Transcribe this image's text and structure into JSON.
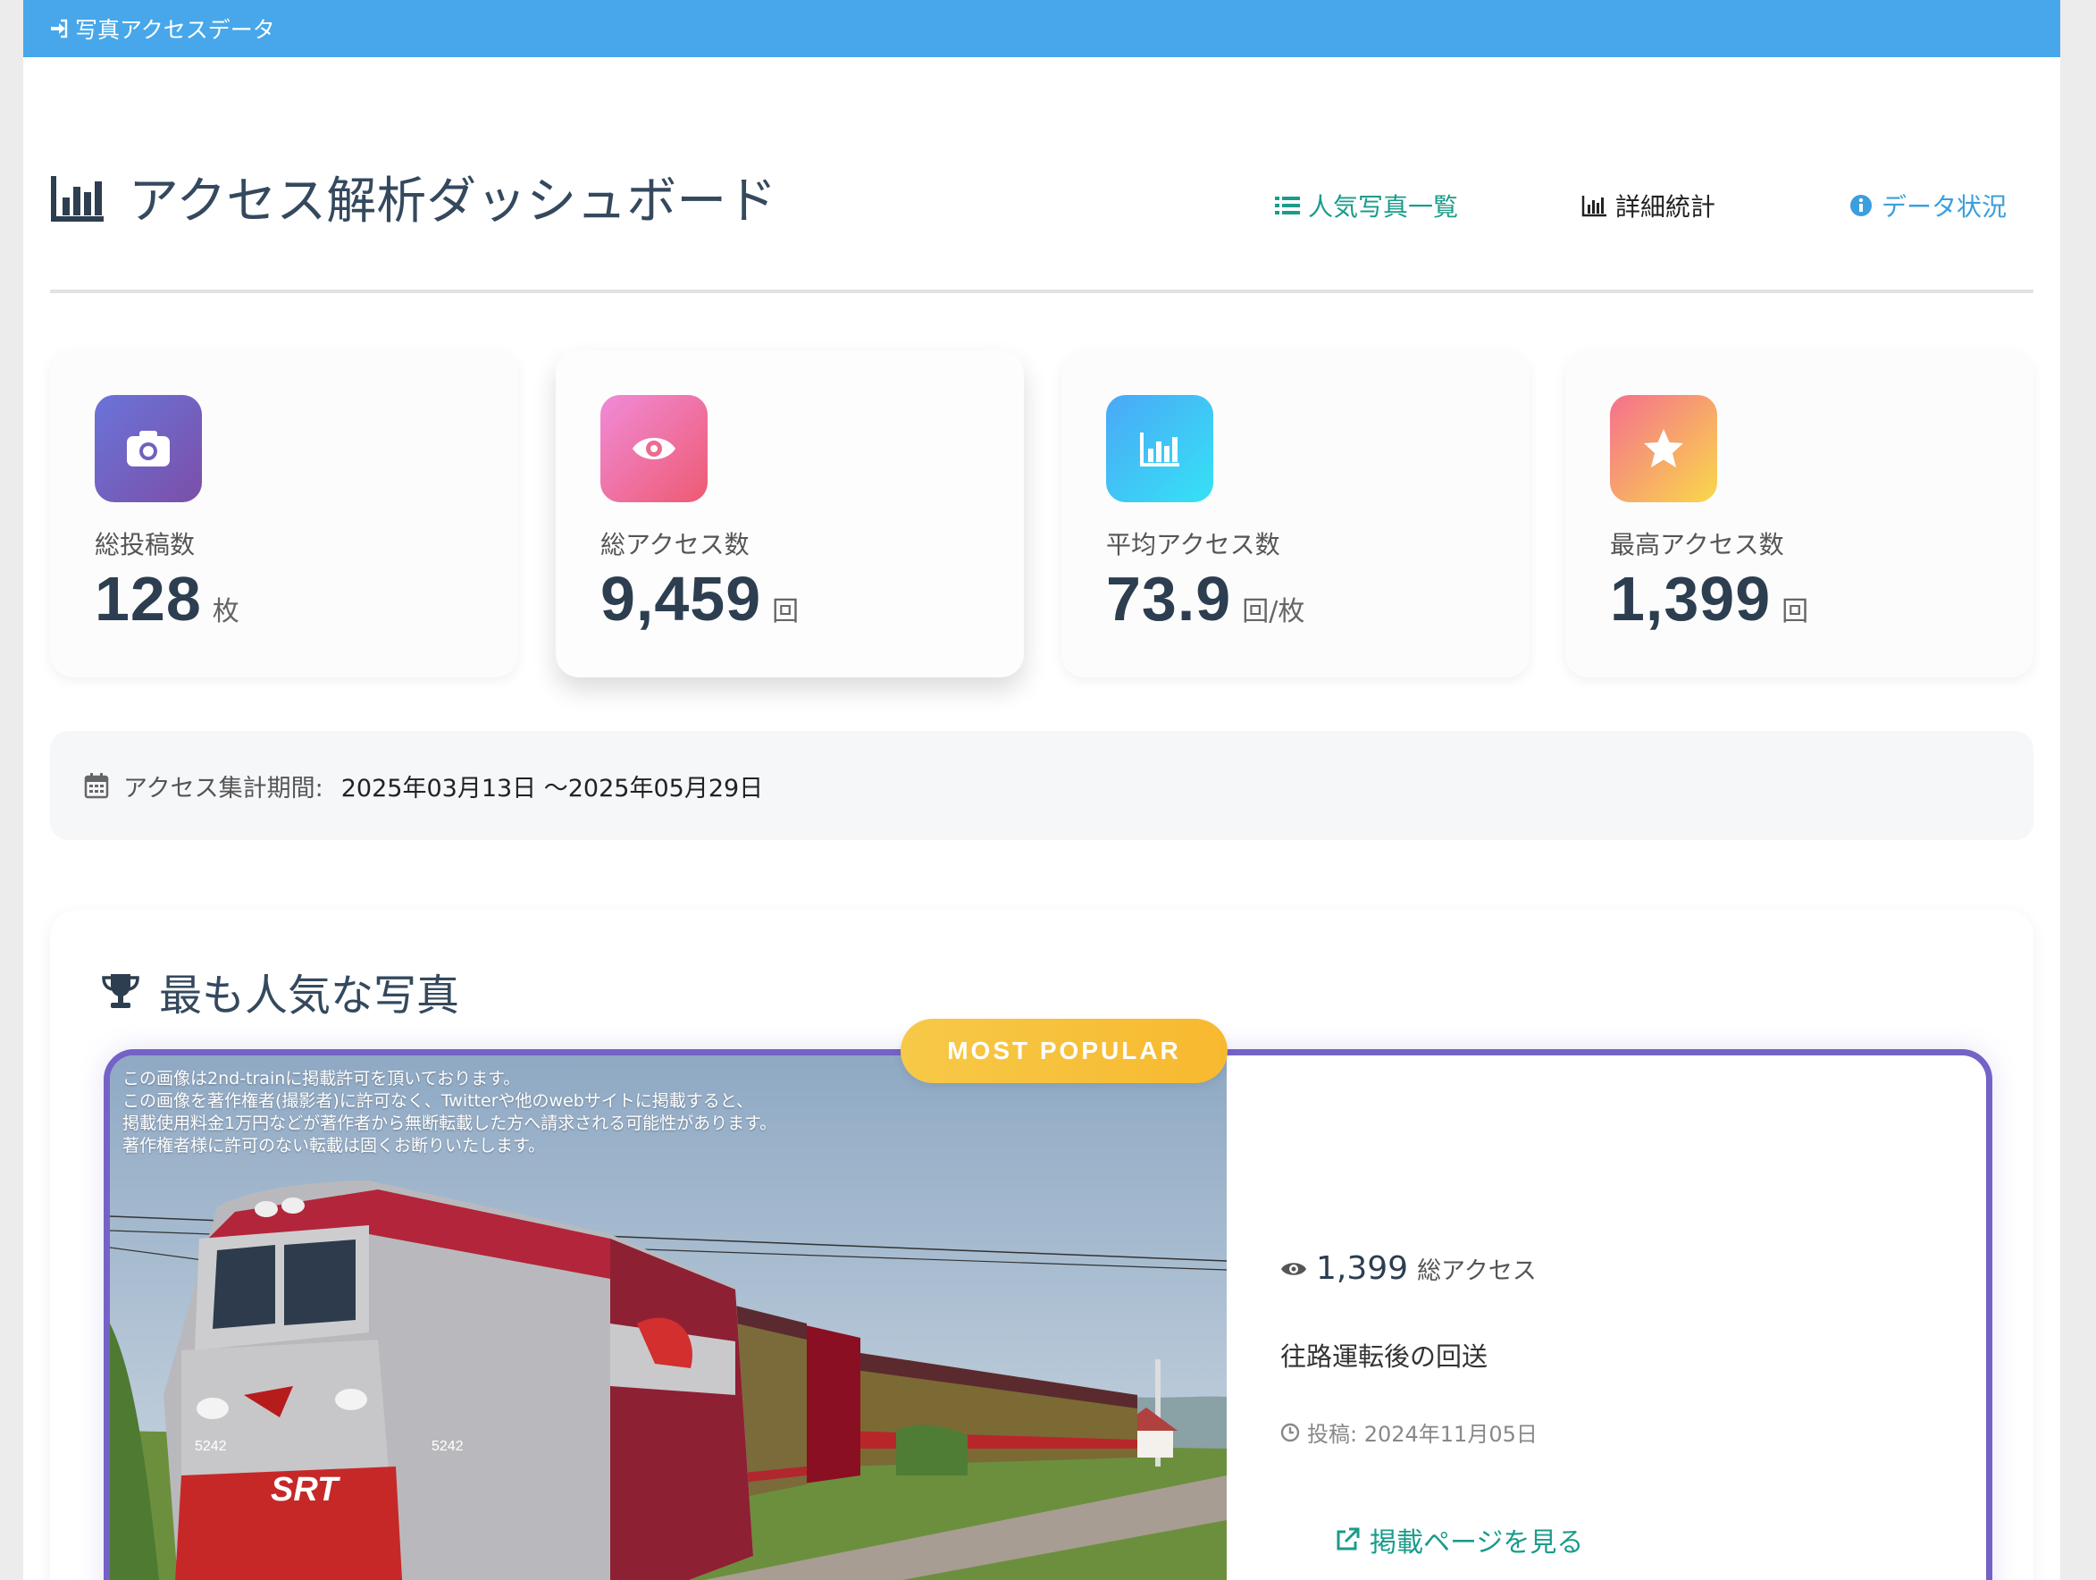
{
  "topbar": {
    "label": "写真アクセスデータ",
    "icon": "sign-in-icon"
  },
  "header": {
    "title": "アクセス解析ダッシュボード",
    "title_icon": "bar-chart-icon",
    "nav": [
      {
        "label": "人気写真一覧",
        "icon": "list-icon",
        "color": "#1a9c8a"
      },
      {
        "label": "詳細統計",
        "icon": "bar-chart-icon",
        "color": "#222222"
      },
      {
        "label": "データ状況",
        "icon": "info-circle-icon",
        "color": "#3b9ede"
      }
    ]
  },
  "stats": [
    {
      "label": "総投稿数",
      "value": "128",
      "unit": "枚",
      "icon": "camera-icon",
      "gradient": [
        "#6a74d9",
        "#7b4fa8"
      ]
    },
    {
      "label": "総アクセス数",
      "value": "9,459",
      "unit": "回",
      "icon": "eye-icon",
      "gradient": [
        "#f08bd8",
        "#ee5a72"
      ]
    },
    {
      "label": "平均アクセス数",
      "value": "73.9",
      "unit": "回/枚",
      "icon": "bar-chart-icon",
      "gradient": [
        "#4aa8f7",
        "#36e2f5"
      ]
    },
    {
      "label": "最高アクセス数",
      "value": "1,399",
      "unit": "回",
      "icon": "star-icon",
      "gradient": [
        "#f5708f",
        "#f9d849"
      ]
    }
  ],
  "period": {
    "label": "アクセス集計期間:",
    "range": "2025年03月13日 〜2025年05月29日",
    "icon": "calendar-icon"
  },
  "popular": {
    "title": "最も人気な写真",
    "title_icon": "trophy-icon",
    "badge": "MOST POPULAR",
    "notice": [
      "この画像は2nd-trainに掲載許可を頂いております。",
      "この画像を著作権者(撮影者)に許可なく、Twitterや他のwebサイトに掲載すると、",
      "掲載使用料金1万円などが著作者から無断転載した方へ請求される可能性があります。",
      "著作権者様に許可のない転載は固くお断りいたします。"
    ],
    "views": "1,399",
    "views_label": "総アクセス",
    "caption": "往路運転後の回送",
    "posted": "投稿: 2024年11月05日",
    "link": "掲載ページを見る",
    "photo_text": {
      "logo": "SRT",
      "number": "5242"
    },
    "accent": "#7562c6"
  }
}
